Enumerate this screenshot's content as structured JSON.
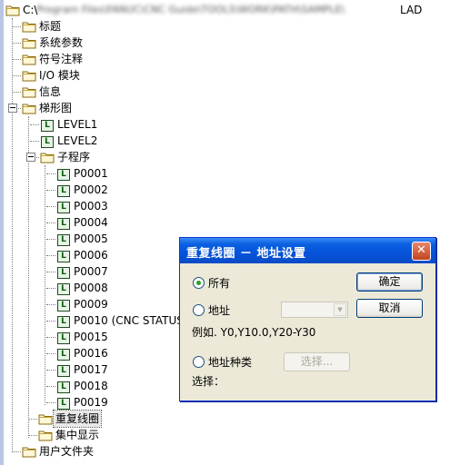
{
  "tree": {
    "root": {
      "path_prefix": "C:\\",
      "path_blurred": "Program Files\\FANUC\\CNC Guide\\TOOLS\\WORK\\PATH\\SAMPLE\\",
      "path_suffix": "LAD"
    },
    "items": [
      {
        "label": "标题"
      },
      {
        "label": "系统参数"
      },
      {
        "label": "符号注释"
      },
      {
        "label": "I/O 模块"
      },
      {
        "label": "信息"
      },
      {
        "label": "梯形图"
      },
      {
        "label": "LEVEL1"
      },
      {
        "label": "LEVEL2"
      },
      {
        "label": "子程序"
      },
      {
        "label": "P0001"
      },
      {
        "label": "P0002"
      },
      {
        "label": "P0003"
      },
      {
        "label": "P0004"
      },
      {
        "label": "P0005"
      },
      {
        "label": "P0006"
      },
      {
        "label": "P0007"
      },
      {
        "label": "P0008"
      },
      {
        "label": "P0009"
      },
      {
        "label": "P0010 (CNC STATUS)"
      },
      {
        "label": "P0015"
      },
      {
        "label": "P0016"
      },
      {
        "label": "P0017"
      },
      {
        "label": "P0018"
      },
      {
        "label": "P0019"
      },
      {
        "label": "重复线圈"
      },
      {
        "label": "集中显示"
      },
      {
        "label": "用户文件夹"
      }
    ],
    "selected": "重复线圈",
    "icon_letter": "L"
  },
  "dialog": {
    "title": "重复线圈 － 地址设置",
    "close_glyph": "✕",
    "options": {
      "all_label": "所有",
      "address_label": "地址",
      "address_example": "例如. Y0,Y10.0,Y20-Y30",
      "address_type_label": "地址种类",
      "select_caption": "选择："
    },
    "selected_option": "所有",
    "buttons": {
      "ok": "确定",
      "cancel": "取消",
      "select": "选择..."
    },
    "address_combo_value": ""
  },
  "colors": {
    "titlebar": "#0553da",
    "dialog_bg": "#ece9d8",
    "folder": "#f4cf5a"
  }
}
